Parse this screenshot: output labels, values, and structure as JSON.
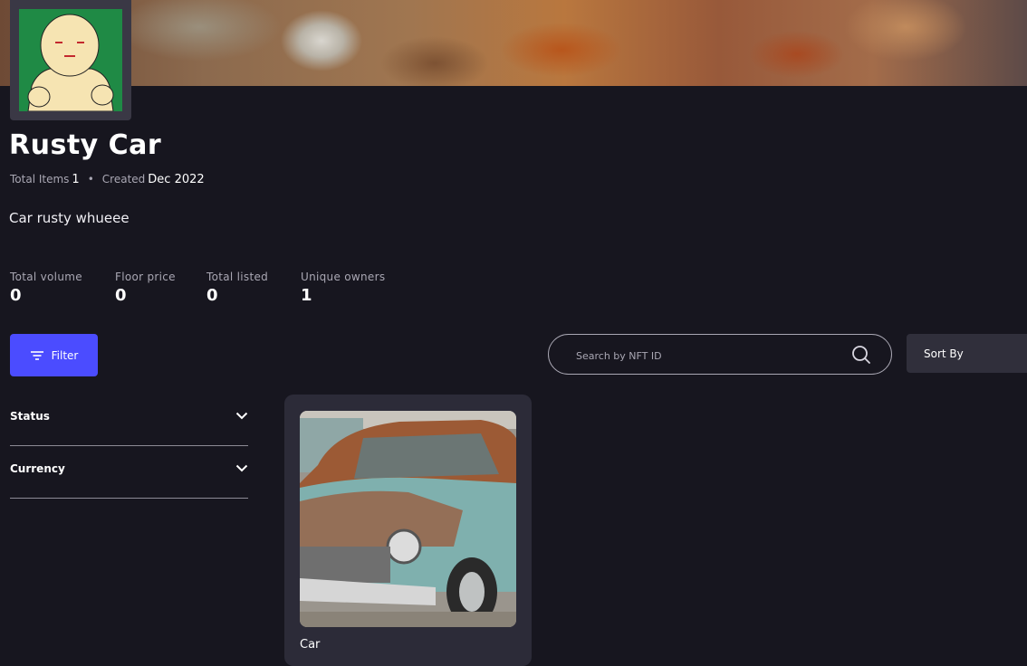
{
  "collection": {
    "title": "Rusty Car",
    "total_items_label": "Total Items",
    "total_items_value": "1",
    "created_label": "Created",
    "created_value": "Dec 2022",
    "description": "Car rusty whueee"
  },
  "stats": [
    {
      "label": "Total volume",
      "value": "0"
    },
    {
      "label": "Floor price",
      "value": "0"
    },
    {
      "label": "Total listed",
      "value": "0"
    },
    {
      "label": "Unique owners",
      "value": "1"
    }
  ],
  "toolbar": {
    "filter_label": "Filter",
    "search_placeholder": "Search by NFT ID",
    "sort_label": "Sort By"
  },
  "filters": [
    {
      "label": "Status"
    },
    {
      "label": "Currency"
    }
  ],
  "items": [
    {
      "name": "Car"
    }
  ],
  "colors": {
    "background": "#17161f",
    "accent": "#4b4cff",
    "card": "#2c2b38"
  }
}
